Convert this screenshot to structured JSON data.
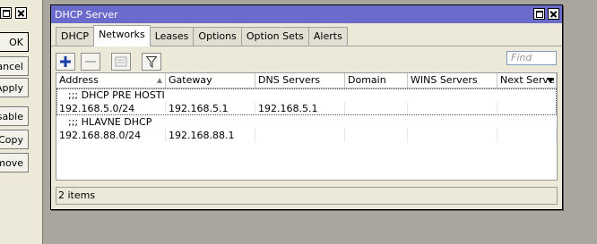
{
  "background_dialog": {
    "buttons": [
      "OK",
      "ancel",
      "Apply",
      "isable",
      "Copy",
      "emove"
    ]
  },
  "window": {
    "title": "DHCP Server",
    "tabs": [
      "DHCP",
      "Networks",
      "Leases",
      "Options",
      "Option Sets",
      "Alerts"
    ],
    "active_tab": "Networks",
    "find_placeholder": "Find",
    "table": {
      "columns": [
        "Address",
        "Gateway",
        "DNS Servers",
        "Domain",
        "WINS Servers",
        "Next Serve"
      ],
      "rows": [
        {
          "comment": ";;; DHCP PRE HOSTI",
          "address": "192.168.5.0/24",
          "gateway": "192.168.5.1",
          "dns_servers": "192.168.5.1",
          "domain": "",
          "wins_servers": "",
          "next_server": ""
        },
        {
          "comment": ";;; HLAVNE DHCP",
          "address": "192.168.88.0/24",
          "gateway": "192.168.88.1",
          "dns_servers": "",
          "domain": "",
          "wins_servers": "",
          "next_server": ""
        }
      ]
    },
    "status": "2 items"
  },
  "colors": {
    "titlebar": "#6b6bcc",
    "add_icon": "#1a3fa8",
    "desktop": "#a9a69d"
  },
  "icons": [
    "maximize-icon",
    "close-icon",
    "add-icon",
    "remove-icon",
    "comment-icon",
    "filter-icon",
    "sort-asc-icon",
    "column-menu-icon"
  ]
}
